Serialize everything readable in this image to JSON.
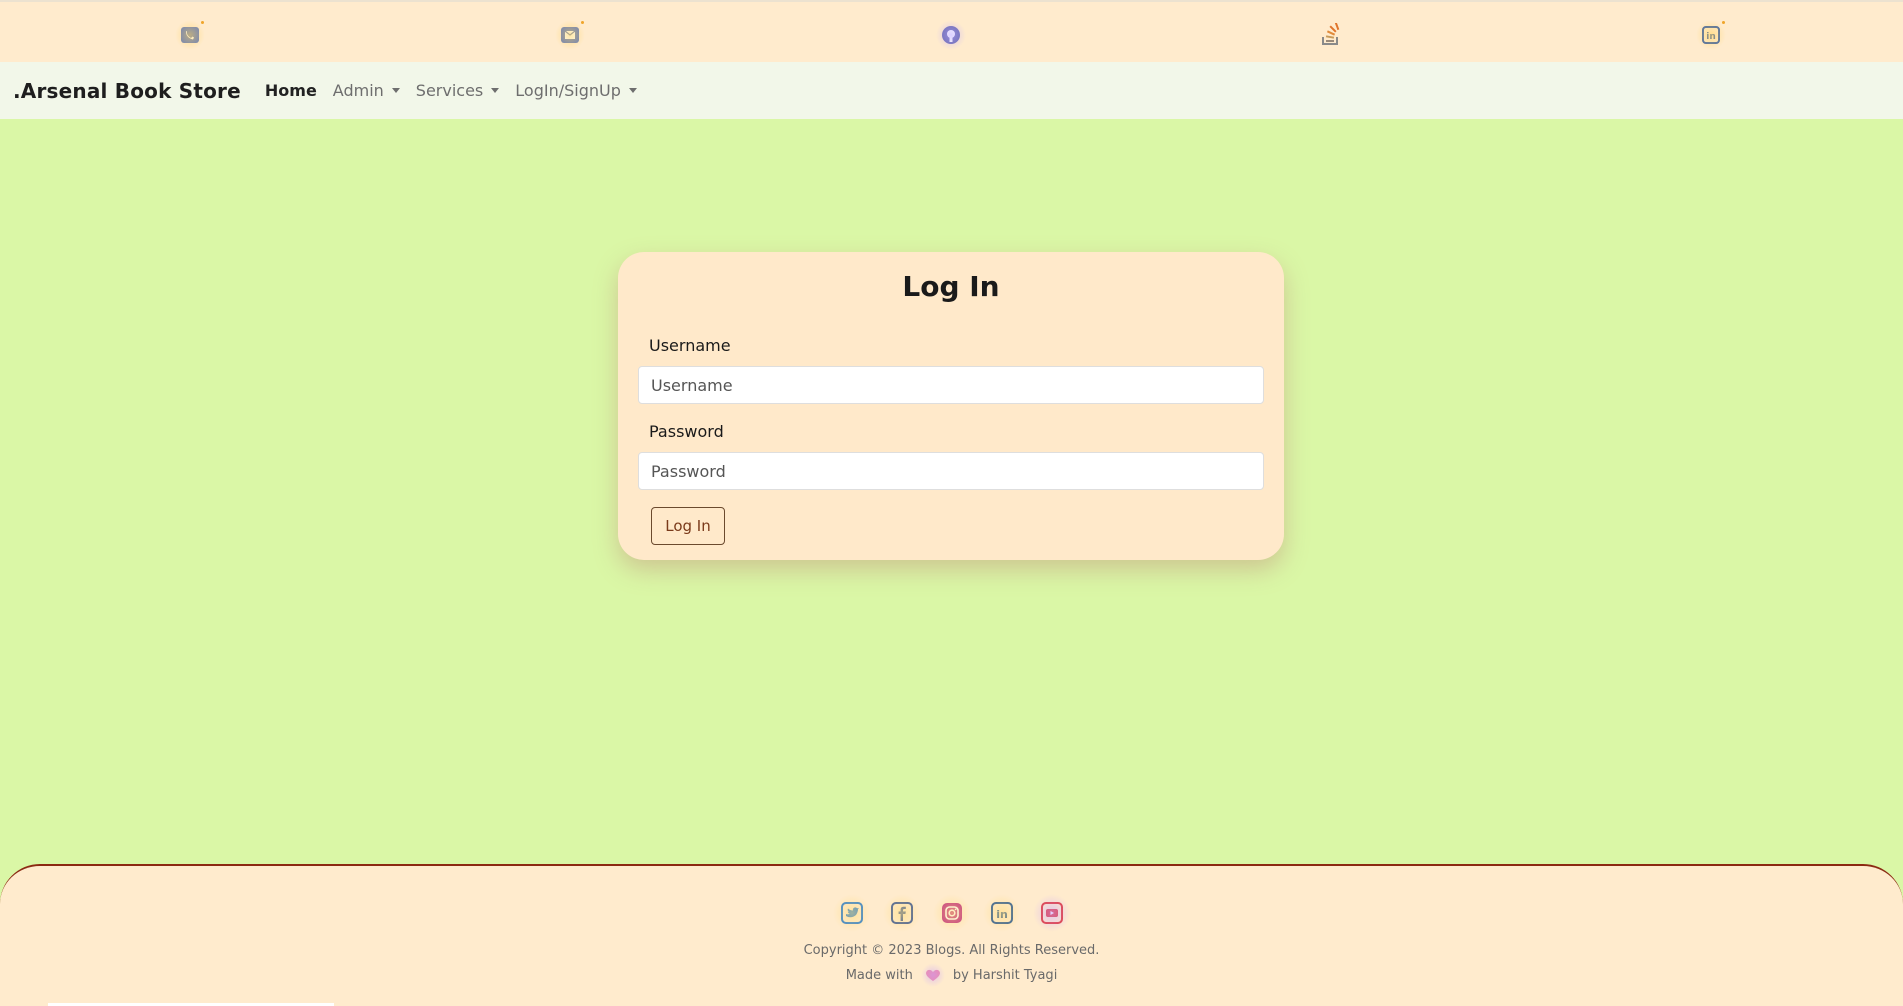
{
  "topbar": {
    "icons": [
      {
        "name": "phone-icon",
        "color": "#6a7fb8"
      },
      {
        "name": "email-icon",
        "color": "#6a7fb8"
      },
      {
        "name": "github-icon",
        "color": "#6a6ab0"
      },
      {
        "name": "stackoverflow-icon",
        "color": "#e0752c"
      },
      {
        "name": "linkedin-icon",
        "color": "#3e64a8"
      }
    ]
  },
  "navbar": {
    "brand": ".Arsenal Book Store",
    "items": [
      {
        "label": "Home",
        "active": true,
        "dropdown": false
      },
      {
        "label": "Admin",
        "active": false,
        "dropdown": true
      },
      {
        "label": "Services",
        "active": false,
        "dropdown": true
      },
      {
        "label": "LogIn/SignUp",
        "active": false,
        "dropdown": true
      }
    ]
  },
  "login": {
    "title": "Log In",
    "username_label": "Username",
    "username_placeholder": "Username",
    "username_value": "",
    "password_label": "Password",
    "password_placeholder": "Password",
    "password_value": "",
    "submit_label": "Log In"
  },
  "footer": {
    "social": [
      {
        "name": "twitter-icon",
        "color": "#2f7fd0"
      },
      {
        "name": "facebook-icon",
        "color": "#3d5a98"
      },
      {
        "name": "instagram-icon",
        "color": "#c13584"
      },
      {
        "name": "linkedin-icon",
        "color": "#2c5b96"
      },
      {
        "name": "youtube-icon",
        "color": "#e03a3a"
      }
    ],
    "copyright": "Copyright © 2023 Blogs. All Rights Reserved.",
    "made_with": "Made with",
    "by": "by Harshit Tyagi"
  },
  "colors": {
    "page_bg": "#daf7a6",
    "topbar_bg": "#ffebcd",
    "navbar_bg": "#f2f7e9",
    "card_bg": "#ffe9ca",
    "footer_border": "#8b2a12"
  }
}
